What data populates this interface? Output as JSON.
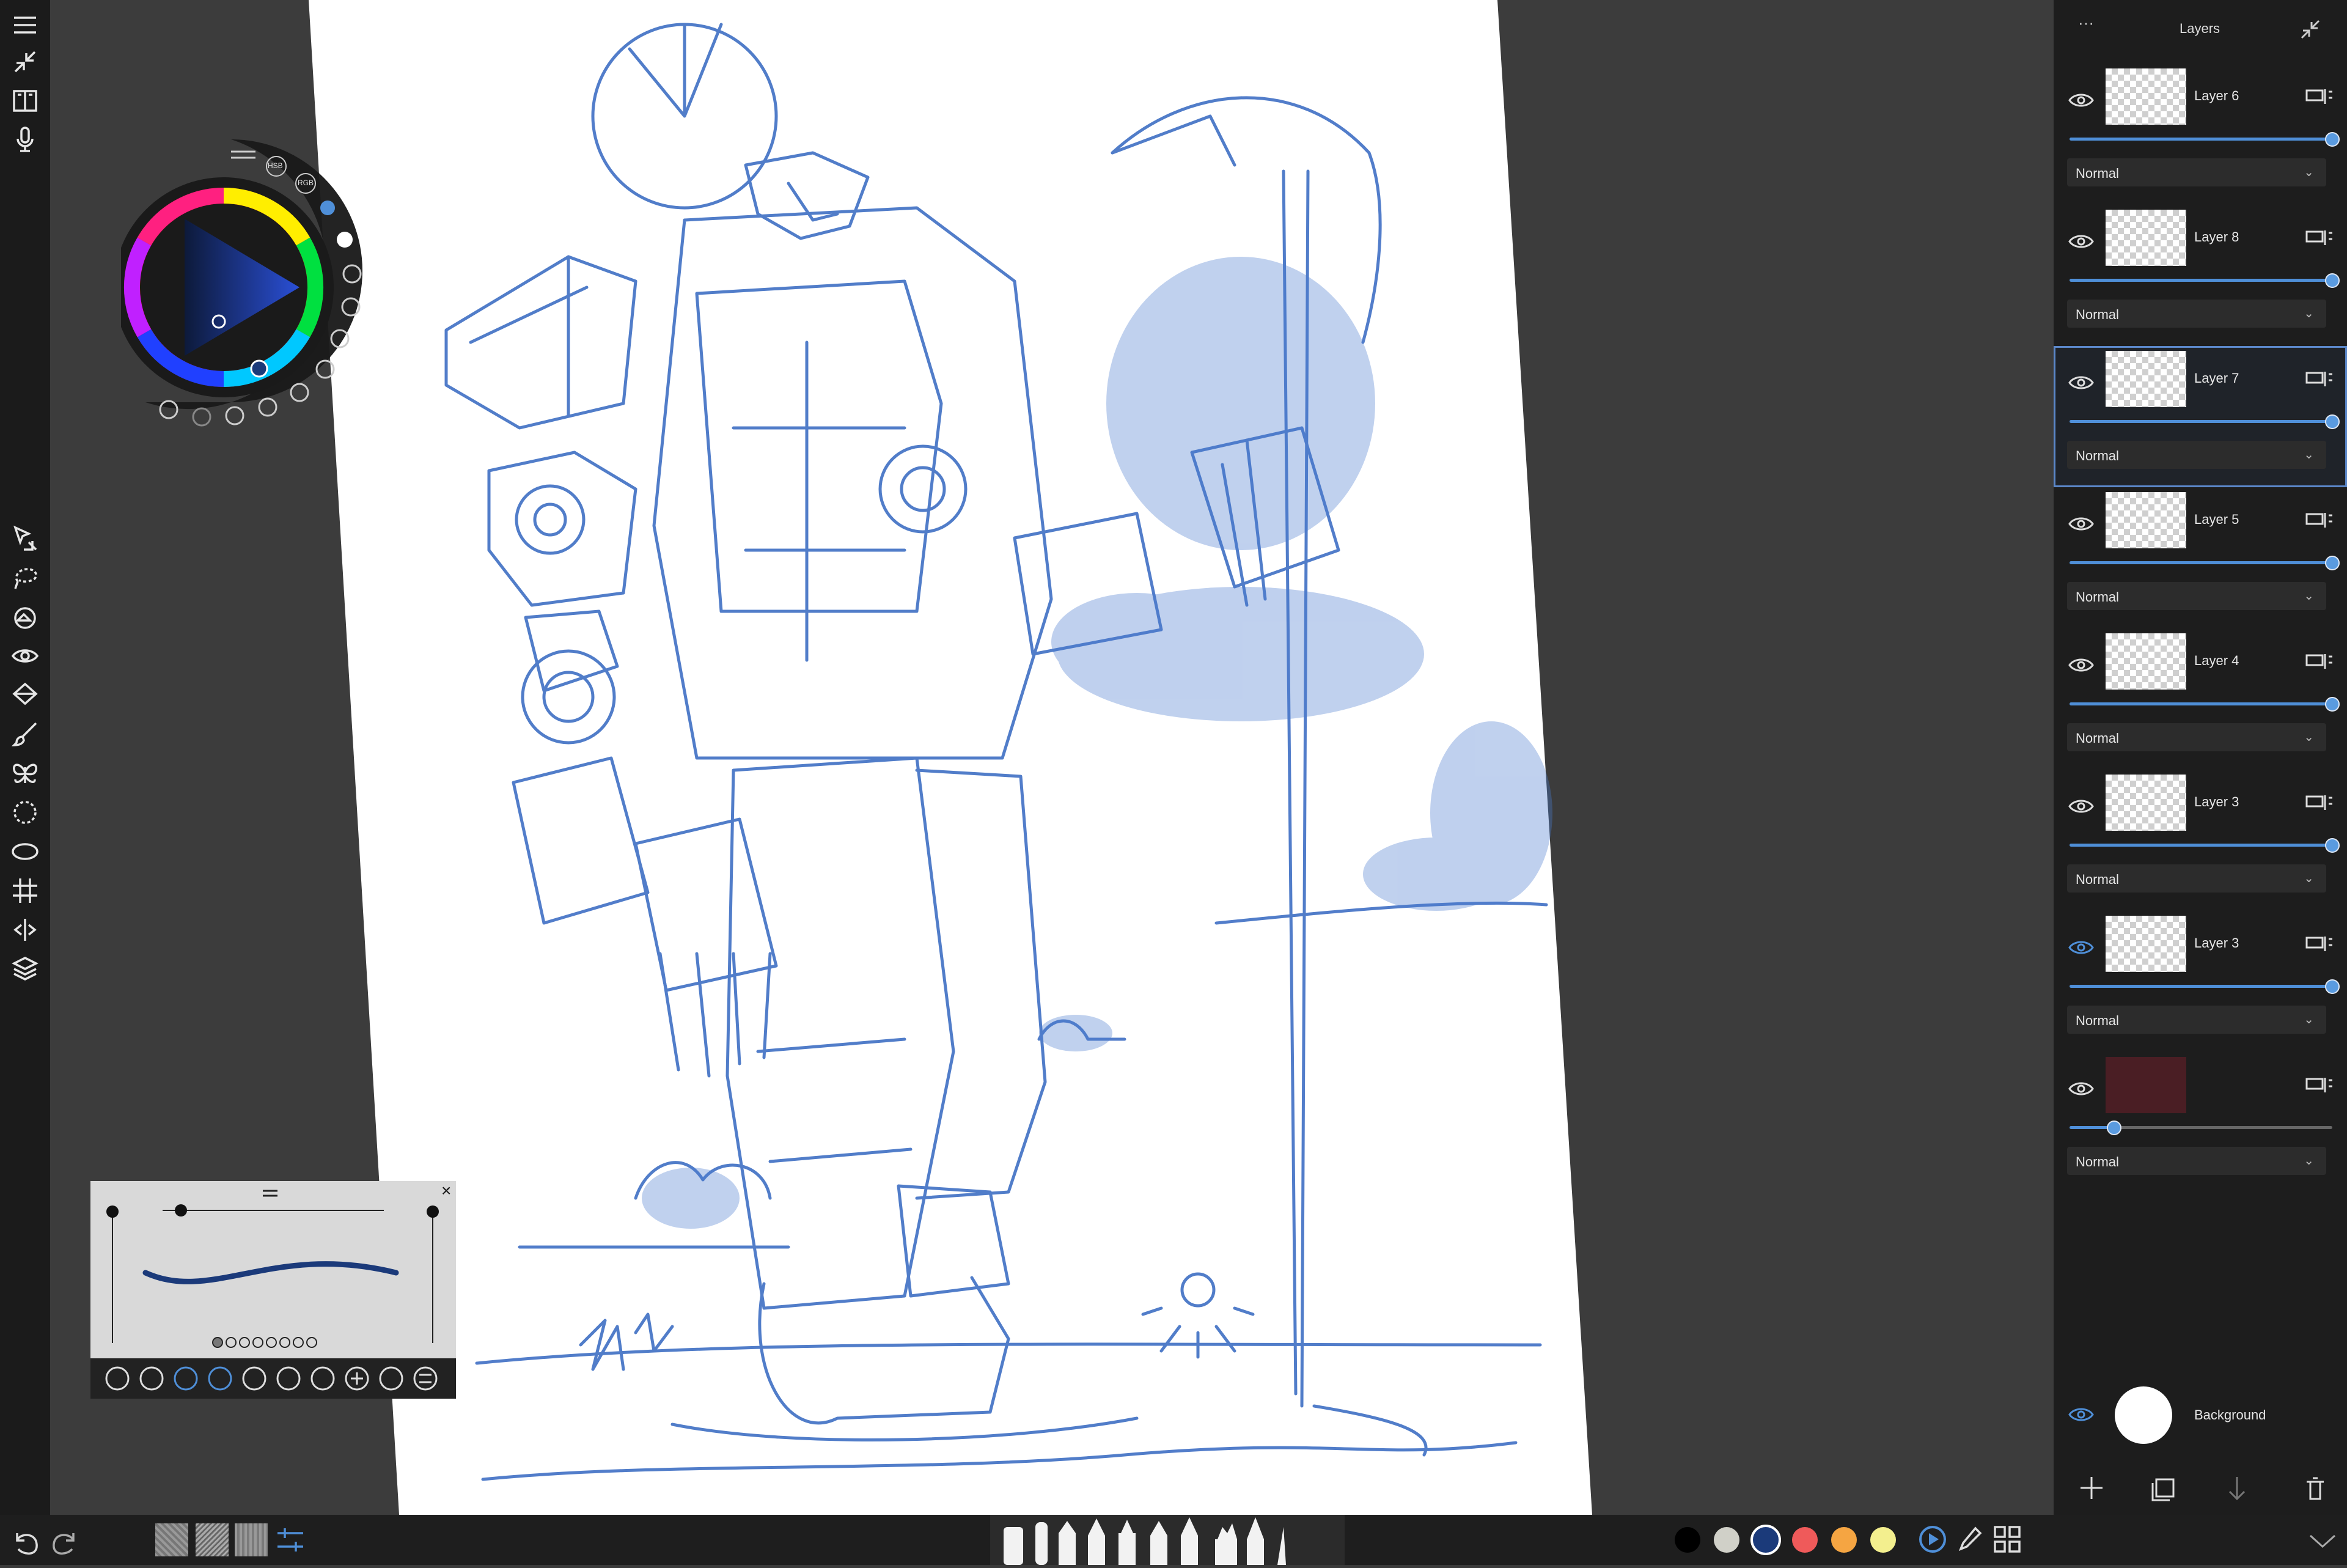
{
  "left_toolbar": {
    "icons": [
      "menu-icon",
      "collapse-icon",
      "book-icon",
      "microphone-icon",
      "transform-icon",
      "lasso-icon",
      "fill-icon",
      "eye-icon",
      "bucket-icon",
      "brush-icon",
      "butterfly-icon",
      "circle-select-icon",
      "ellipse-icon",
      "grid-icon",
      "symmetry-icon",
      "layers-icon"
    ]
  },
  "color_puck": {
    "mode_hsb": "HSB",
    "mode_rgb": "RGB",
    "current_color": "#1b3a7a"
  },
  "brush_panel": {
    "close_label": "×",
    "tool_icons": [
      "stabilizer-icon",
      "stroke-icon",
      "pressure-icon",
      "velocity-icon",
      "scatter-icon",
      "lock-icon",
      "rotate-icon",
      "add-icon",
      "delete-icon",
      "settings-icon"
    ]
  },
  "layers_panel": {
    "title": "Layers",
    "more_label": "···",
    "layers": [
      {
        "name": "Layer 6",
        "blend": "Normal",
        "opacity": 1.0
      },
      {
        "name": "Layer 8",
        "blend": "Normal",
        "opacity": 1.0
      },
      {
        "name": "Layer 7",
        "blend": "Normal",
        "opacity": 1.0,
        "selected": true
      },
      {
        "name": "Layer 5",
        "blend": "Normal",
        "opacity": 1.0
      },
      {
        "name": "Layer 4",
        "blend": "Normal",
        "opacity": 1.0
      },
      {
        "name": "Layer 3",
        "blend": "Normal",
        "opacity": 1.0
      },
      {
        "name": "Layer 3",
        "blend": "Normal",
        "opacity": 1.0
      },
      {
        "name": "",
        "blend": "Normal",
        "opacity": 0.17
      }
    ],
    "background_label": "Background"
  },
  "palette": [
    "#000000",
    "#d0d0c8",
    "#1b3a7a",
    "#ef5a5a",
    "#f5a542",
    "#f3ef8e"
  ],
  "colors": {
    "accent": "#4f8fd8",
    "sketch": "#3f6fc4"
  }
}
